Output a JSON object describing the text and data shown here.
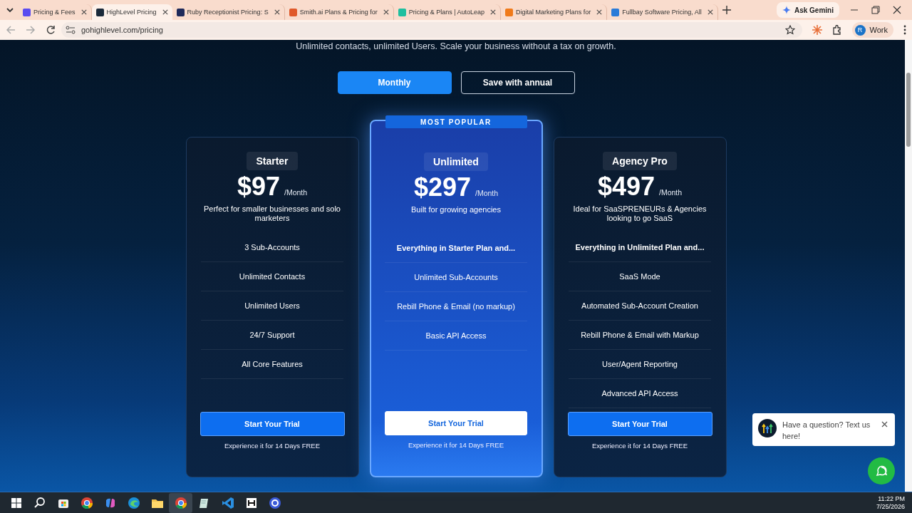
{
  "browser": {
    "tabs": [
      {
        "title": "Pricing & Fees",
        "selected": false,
        "color": "#5b4cf0"
      },
      {
        "title": "HighLevel Pricing",
        "selected": true,
        "color": "#1b2a3a"
      },
      {
        "title": "Ruby Receptionist Pricing: S",
        "selected": false,
        "color": "#1f2a5a"
      },
      {
        "title": "Smith.ai Plans & Pricing for",
        "selected": false,
        "color": "#e0592a"
      },
      {
        "title": "Pricing & Plans | AutoLeap",
        "selected": false,
        "color": "#1fbf9f"
      },
      {
        "title": "Digital Marketing Plans for",
        "selected": false,
        "color": "#f07a1a"
      },
      {
        "title": "Fullbay Software Pricing, All",
        "selected": false,
        "color": "#2a7bd8"
      }
    ],
    "ask_button": "Ask Gemini",
    "url": "gohighlevel.com/pricing",
    "profile": {
      "initial": "R",
      "label": "Work"
    }
  },
  "page": {
    "subtitle": "Unlimited contacts, unlimited Users. Scale your business without a tax on growth.",
    "billing": [
      {
        "label": "Monthly",
        "selected": true
      },
      {
        "label": "Save with annual",
        "selected": false
      }
    ],
    "plans": [
      {
        "name": "Starter",
        "price": "$97",
        "period": "/Month",
        "description": "Perfect for smaller businesses and solo marketers",
        "featured": false,
        "features": [
          {
            "text": "3 Sub-Accounts",
            "kind": "item"
          },
          {
            "text": "Unlimited Contacts",
            "kind": "item"
          },
          {
            "text": "Unlimited Users",
            "kind": "item"
          },
          {
            "text": "24/7 Support",
            "kind": "item"
          },
          {
            "text": "All Core Features",
            "kind": "item"
          }
        ],
        "button": "Start Your Trial",
        "note": "Experience it for 14 Days FREE"
      },
      {
        "name": "Unlimited",
        "price": "$297",
        "period": "/Month",
        "description": "Built for growing agencies",
        "featured": true,
        "badge": "MOST POPULAR",
        "features": [
          {
            "text": "Everything in Starter Plan and...",
            "kind": "heading"
          },
          {
            "text": "Unlimited Sub-Accounts",
            "kind": "item"
          },
          {
            "text": "Rebill Phone & Email (no markup)",
            "kind": "item"
          },
          {
            "text": "Basic API Access",
            "kind": "item"
          }
        ],
        "button": "Start Your Trial",
        "note": "Experience it for 14 Days FREE"
      },
      {
        "name": "Agency Pro",
        "price": "$497",
        "period": "/Month",
        "description": "Ideal for SaaSPRENEURs & Agencies looking to go SaaS",
        "featured": false,
        "features": [
          {
            "text": "Everything in Unlimited Plan and...",
            "kind": "heading"
          },
          {
            "text": "SaaS Mode",
            "kind": "item"
          },
          {
            "text": "Automated Sub-Account Creation",
            "kind": "item"
          },
          {
            "text": "Rebill Phone & Email with Markup",
            "kind": "item"
          },
          {
            "text": "User/Agent Reporting",
            "kind": "item"
          },
          {
            "text": "Advanced API Access",
            "kind": "item"
          }
        ],
        "button": "Start Your Trial",
        "note": "Experience it for 14 Days FREE"
      }
    ],
    "chat": {
      "message": "Have a question? Text us here!"
    }
  },
  "taskbar": {
    "apps": [
      {
        "kind": "start",
        "selected": false
      },
      {
        "kind": "search",
        "selected": false
      },
      {
        "kind": "store",
        "selected": false
      },
      {
        "kind": "chrome",
        "selected": false
      },
      {
        "kind": "copilot",
        "selected": false
      },
      {
        "kind": "edge",
        "selected": false
      },
      {
        "kind": "folder",
        "selected": false
      },
      {
        "kind": "chrome",
        "selected": true
      },
      {
        "kind": "notes",
        "selected": false
      },
      {
        "kind": "vscode",
        "selected": false
      },
      {
        "kind": "letter",
        "selected": false
      },
      {
        "kind": "circle",
        "selected": false
      }
    ],
    "time": "11:22 PM",
    "date": "7/25/2026"
  }
}
